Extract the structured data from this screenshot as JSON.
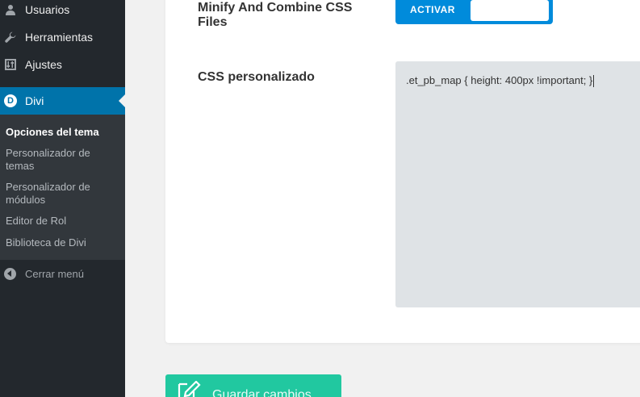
{
  "sidebar": {
    "items": [
      {
        "label": "Usuarios",
        "icon": "users-icon"
      },
      {
        "label": "Herramientas",
        "icon": "wrench-icon"
      },
      {
        "label": "Ajustes",
        "icon": "settings-icon"
      },
      {
        "label": "Divi",
        "icon": "divi-icon",
        "icon_letter": "D",
        "active": true
      }
    ],
    "submenu": [
      {
        "label": "Opciones del tema",
        "current": true
      },
      {
        "label": "Personalizador de temas"
      },
      {
        "label": "Personalizador de módulos"
      },
      {
        "label": "Editor de Rol"
      },
      {
        "label": "Biblioteca de Divi"
      }
    ],
    "collapse_label": "Cerrar menú"
  },
  "options": {
    "minify": {
      "label": "Minify And Combine CSS Files",
      "toggle_label": "ACTIVAR"
    },
    "custom_css": {
      "label": "CSS personalizado",
      "value": ".et_pb_map { height: 400px !important; }"
    }
  },
  "save_button": {
    "label": "Guardar cambios",
    "icon": "pencil-icon"
  },
  "colors": {
    "sidebar_bg": "#23282d",
    "submenu_bg": "#32373c",
    "active_bg": "#0073aa",
    "toggle_blue": "#008bdb",
    "save_green": "#21c8a0",
    "textarea_bg": "#dfe3e6"
  }
}
